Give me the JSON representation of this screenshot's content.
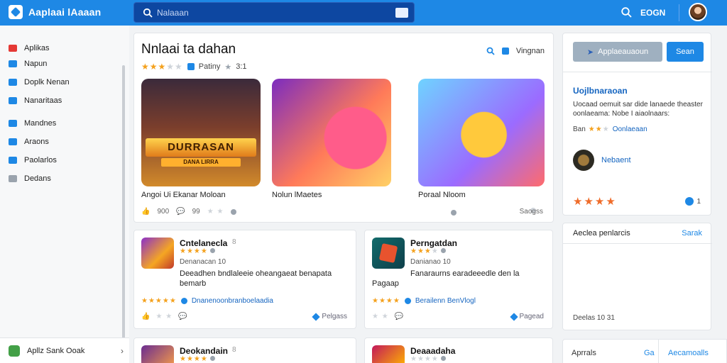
{
  "header": {
    "app_title": "Aaplaai lAaaan",
    "search_placeholder": "Nalaaan",
    "right_text": "EOGN",
    "accent": "#1e88e5"
  },
  "sidebar": {
    "items": [
      {
        "label": "Aplikas",
        "icon": "home-icon",
        "color": "#e53935"
      },
      {
        "label": "Napun",
        "icon": "apps-icon",
        "color": "#1e88e5"
      },
      {
        "label": "Doplk Nenan",
        "icon": "doc-icon",
        "color": "#1e88e5"
      },
      {
        "label": "Nanaritaas",
        "icon": "grid-icon",
        "color": "#1e88e5"
      },
      {
        "label": "Mandnes",
        "icon": "cloud-icon",
        "color": "#1e88e5"
      },
      {
        "label": "Araons",
        "icon": "list-icon",
        "color": "#1e88e5"
      },
      {
        "label": "Paolarlos",
        "icon": "edit-icon",
        "color": "#1e88e5"
      },
      {
        "label": "Dedans",
        "icon": "gear-icon",
        "color": "#9aa3ad"
      }
    ],
    "bottom_label": "Apllz Sank Ooak"
  },
  "hero": {
    "title": "Nnlaai ta dahan",
    "rating_stars": 3,
    "rating_label": "Patiny",
    "rating_count": "3:1",
    "tools_label": "Vingnan",
    "arts": [
      {
        "banner": "DURRASAN",
        "sub": "DANA LIRRA",
        "caption": "Angoi Ui Ekanar Moloan"
      },
      {
        "caption": "Nolun lMaetes"
      },
      {
        "caption": "Poraal Nloom"
      }
    ],
    "foot_count_1": "900",
    "foot_count_2": "99",
    "foot_right": "Saogss"
  },
  "side_card": {
    "btn_primary": "Applaeauaoun",
    "btn_secondary": "Sean",
    "heading": "Uojlbnaraoan",
    "desc": "Uocaad oemuit sar dide lanaede theaster oonlaeama: Nobe I aiaolnaars:",
    "rating_label": "Ban",
    "rating_link": "Oonlaeaan",
    "app_name": "Nebaent",
    "stars": "★★★★",
    "badge_count": "1"
  },
  "recent": {
    "title": "Aeclea penlarcis",
    "link": "Sarak",
    "foot": "Deelas 10 31"
  },
  "bottom_bar": {
    "left": "Aprrals",
    "mid": "Ga",
    "right": "Aecamoalls"
  },
  "apps": [
    {
      "name": "Cntelanecla",
      "num": "8",
      "meta": "Denanacan 10",
      "desc_1": "Deeadhen bndlaleeie oheangaeat benapata",
      "desc_2": "bemarb",
      "dev": "Dnanenoonbranboelaadia",
      "foot_right": "Pelgass"
    },
    {
      "name": "Perngatdan",
      "num": "",
      "meta": "Danianao 10",
      "desc_1": "Fanaraurns earadeeedle den la",
      "desc_2": "Pagaap",
      "dev": "Berailenn BenVlogl",
      "foot_right": "Pagead"
    },
    {
      "name": "Deokandain",
      "num": "8"
    },
    {
      "name": "Deaaadaha",
      "num": ""
    }
  ]
}
